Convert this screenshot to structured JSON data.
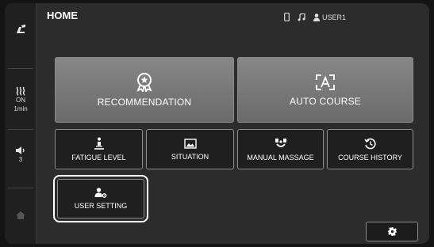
{
  "header": {
    "title": "HOME",
    "user": "USER1"
  },
  "sidebar": {
    "heat_state": "ON",
    "heat_timer": "1min",
    "volume_level": "3"
  },
  "main": {
    "large_buttons": [
      {
        "label": "RECOMMENDATION",
        "icon": "award-ribbon-star-icon"
      },
      {
        "label": "AUTO COURSE",
        "icon": "auto-course-icon"
      }
    ],
    "small_buttons": [
      {
        "label": "FATIGUE LEVEL",
        "icon": "fatigue-level-icon"
      },
      {
        "label": "SITUATION",
        "icon": "situation-image-icon"
      },
      {
        "label": "MANUAL MASSAGE",
        "icon": "manual-massage-icon"
      },
      {
        "label": "COURSE HISTORY",
        "icon": "history-icon"
      },
      {
        "label": "USER SETTING",
        "icon": "user-gear-icon"
      }
    ]
  },
  "colors": {
    "background": "#2c2c2c",
    "sidebar": "#202020",
    "large_button": "#7a7a7a",
    "small_button": "#1f1f1f",
    "focus_outline": "#ffffff"
  }
}
